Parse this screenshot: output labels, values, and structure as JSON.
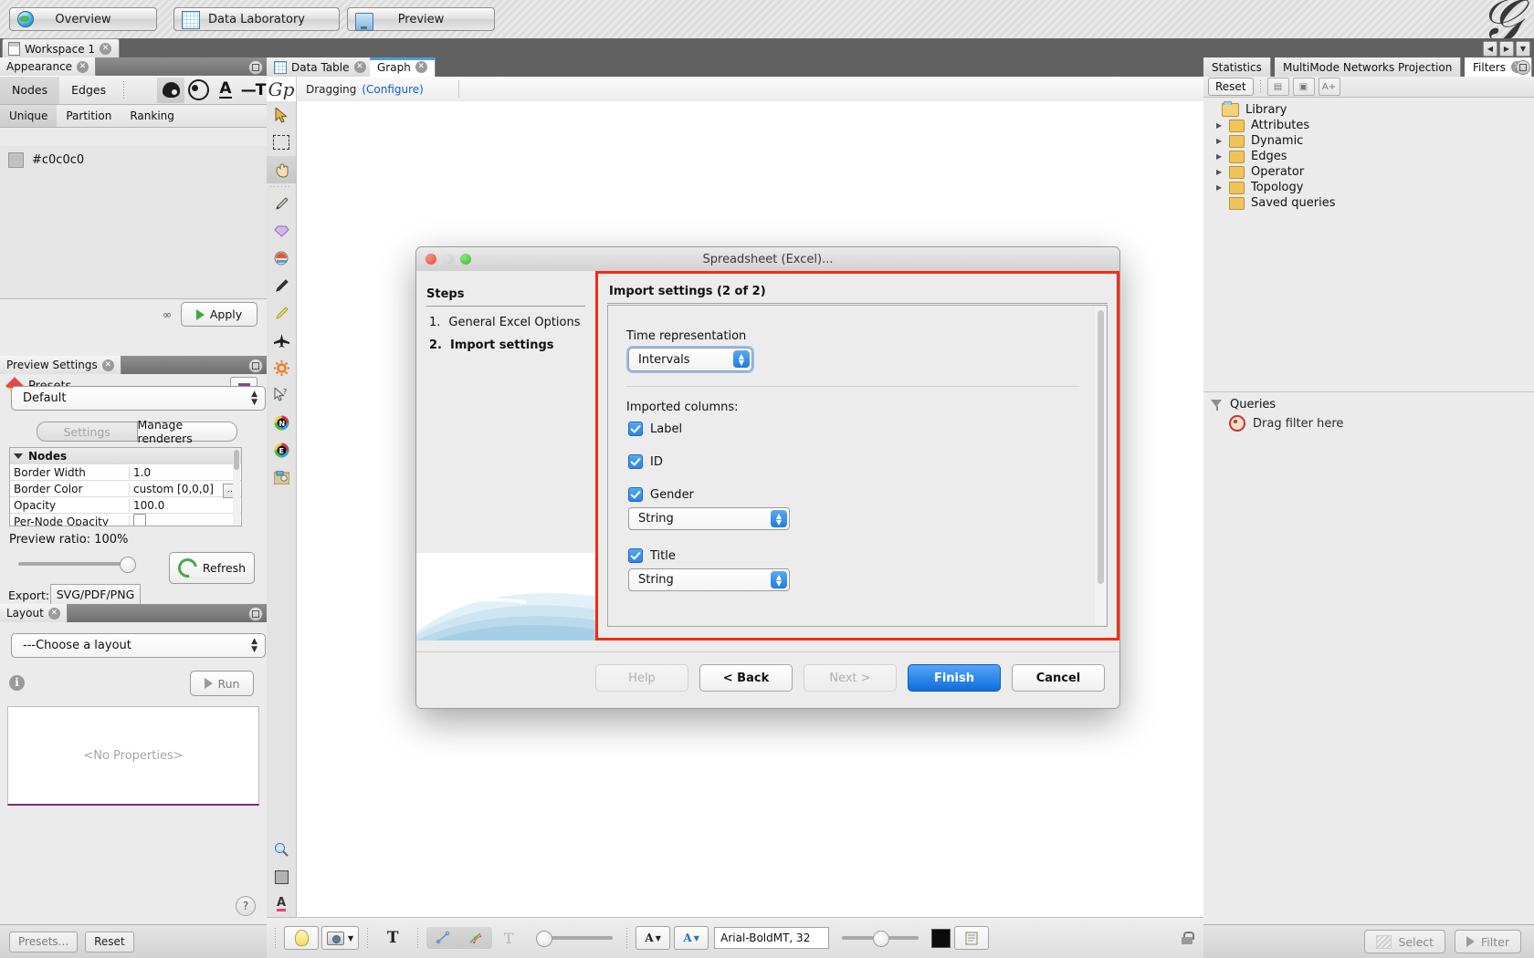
{
  "toolbar": {
    "modes": [
      {
        "label": "Overview",
        "icon": "globe-icon"
      },
      {
        "label": "Data Laboratory",
        "icon": "spreadsheet-icon"
      },
      {
        "label": "Preview",
        "icon": "monitor-icon"
      }
    ],
    "logo": "Gephi"
  },
  "workspace": {
    "tab_label": "Workspace 1"
  },
  "appearance": {
    "title": "Appearance",
    "element_tabs": [
      {
        "label": "Nodes",
        "selected": true
      },
      {
        "label": "Edges",
        "selected": false
      }
    ],
    "attribute_icons": [
      "palette-icon",
      "size-icon",
      "label-color-icon",
      "label-size-icon"
    ],
    "mode_tabs": [
      {
        "label": "Unique",
        "selected": true
      },
      {
        "label": "Partition",
        "selected": false
      },
      {
        "label": "Ranking",
        "selected": false
      }
    ],
    "color_value": "#c0c0c0",
    "swatch_color": "#c0c0c0",
    "apply_label": "Apply"
  },
  "preview_settings": {
    "title": "Preview Settings",
    "presets_label": "Presets",
    "preset_value": "Default",
    "segments": [
      {
        "label": "Settings",
        "selected": false
      },
      {
        "label": "Manage renderers",
        "selected": true
      }
    ],
    "properties": {
      "group": "Nodes",
      "rows": [
        {
          "key": "Border Width",
          "value": "1.0",
          "type": "text"
        },
        {
          "key": "Border Color",
          "value": "custom [0,0,0]",
          "type": "color",
          "button": "..."
        },
        {
          "key": "Opacity",
          "value": "100.0",
          "type": "text"
        },
        {
          "key": "Per-Node Opacity",
          "value": "",
          "type": "checkbox"
        }
      ]
    },
    "ratio_label": "Preview ratio:",
    "ratio_value": "100%",
    "refresh_label": "Refresh",
    "export_label": "Export:",
    "export_value": "SVG/PDF/PNG"
  },
  "layout": {
    "title": "Layout",
    "chooser_value": "---Choose a layout",
    "run_label": "Run",
    "no_properties": "<No Properties>",
    "help_glyph": "?",
    "status_presets": "Presets...",
    "status_reset": "Reset"
  },
  "center": {
    "tabs": [
      {
        "label": "Data Table",
        "active": false,
        "icon": "table-icon"
      },
      {
        "label": "Graph",
        "active": true
      }
    ],
    "dragging_label": "Dragging",
    "configure_label": "(Configure)",
    "logo_glyph": "Gp",
    "tools": [
      "cursor-icon",
      "rectangle-select-icon",
      "hand-icon",
      "brush-icon",
      "diamond-icon",
      "paint-icon",
      "pencil-icon",
      "highlighter-icon",
      "airplane-icon",
      "sun-icon",
      "cursor-help-icon",
      "node-color-icon",
      "edge-color-icon",
      "screenshot-icon"
    ],
    "bottom_tools": [
      "bulb-icon",
      "camera-icon",
      "text-bold-icon",
      "edge-line-icon",
      "edge-rainbow-icon",
      "edge-label-icon"
    ],
    "font_value": "Arial-BoldMT, 32",
    "node_label_a": "A",
    "edge_label_a": "A"
  },
  "right": {
    "tabs": [
      {
        "label": "Statistics",
        "active": false
      },
      {
        "label": "MultiMode Networks Projection",
        "active": false
      },
      {
        "label": "Filters",
        "active": true
      }
    ],
    "reset_label": "Reset",
    "tree": [
      {
        "label": "Library",
        "depth": 0,
        "expandable": false,
        "root": true
      },
      {
        "label": "Attributes",
        "depth": 1,
        "expandable": true
      },
      {
        "label": "Dynamic",
        "depth": 1,
        "expandable": true
      },
      {
        "label": "Edges",
        "depth": 1,
        "expandable": true
      },
      {
        "label": "Operator",
        "depth": 1,
        "expandable": true
      },
      {
        "label": "Topology",
        "depth": 1,
        "expandable": true
      },
      {
        "label": "Saved queries",
        "depth": 1,
        "expandable": false
      }
    ],
    "queries_label": "Queries",
    "drag_filter_label": "Drag filter here",
    "select_label": "Select",
    "filter_label": "Filter"
  },
  "dialog": {
    "title": "Spreadsheet (Excel)...",
    "steps_title": "Steps",
    "steps": [
      {
        "num": "1.",
        "label": "General Excel Options",
        "current": false
      },
      {
        "num": "2.",
        "label": "Import settings",
        "current": true
      }
    ],
    "page_title": "Import settings (2 of 2)",
    "time_representation_label": "Time representation",
    "time_representation_value": "Intervals",
    "imported_columns_label": "Imported columns:",
    "columns": [
      {
        "name": "Label",
        "checked": true,
        "type": null
      },
      {
        "name": "ID",
        "checked": true,
        "type": null
      },
      {
        "name": "Gender",
        "checked": true,
        "type": "String"
      },
      {
        "name": "Title",
        "checked": true,
        "type": "String"
      }
    ],
    "buttons": [
      {
        "label": "Help",
        "state": "disabled"
      },
      {
        "label": "< Back",
        "state": "normal"
      },
      {
        "label": "Next >",
        "state": "disabled"
      },
      {
        "label": "Finish",
        "state": "primary"
      },
      {
        "label": "Cancel",
        "state": "normal"
      }
    ],
    "highlight_color": "#f62a10"
  }
}
